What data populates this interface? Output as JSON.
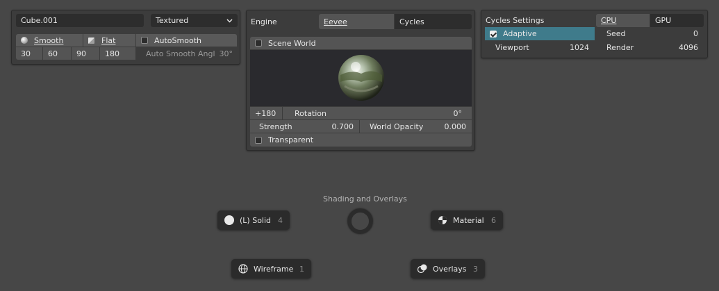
{
  "object_panel": {
    "name": "Cube.001",
    "display_mode": "Textured",
    "smooth_label": "Smooth",
    "flat_label": "Flat",
    "autosmooth_label": "AutoSmooth",
    "angle_presets": [
      "30",
      "60",
      "90",
      "180"
    ],
    "autosmooth_angle_label": "Auto Smooth Angl",
    "autosmooth_angle_value": "30°"
  },
  "render_panel": {
    "engine_label": "Engine",
    "engines": [
      "Eevee",
      "Cycles"
    ],
    "scene_world_label": "Scene World",
    "rotation_offset": "+180",
    "rotation_label": "Rotation",
    "rotation_value": "0°",
    "strength_label": "Strength",
    "strength_value": "0.700",
    "world_opacity_label": "World Opacity",
    "world_opacity_value": "0.000",
    "transparent_label": "Transparent"
  },
  "cycles_panel": {
    "title": "Cycles Settings",
    "devices": [
      "CPU",
      "GPU"
    ],
    "adaptive_label": "Adaptive",
    "seed_label": "Seed",
    "seed_value": "0",
    "viewport_label": "Viewport",
    "viewport_value": "1024",
    "render_label": "Render",
    "render_value": "4096"
  },
  "pie_menu": {
    "title": "Shading and Overlays",
    "solid": {
      "label": "(L) Solid",
      "key": "4"
    },
    "material": {
      "label": "Material",
      "key": "6"
    },
    "wireframe": {
      "label": "Wireframe",
      "key": "1"
    },
    "overlays": {
      "label": "Overlays",
      "key": "3"
    }
  },
  "colors": {
    "background": "#474747",
    "panel": "#3c3c3c",
    "field": "#2d2d2d",
    "button": "#595959",
    "selected": "#4772b3",
    "adaptive_highlight": "#3f7b8b"
  }
}
